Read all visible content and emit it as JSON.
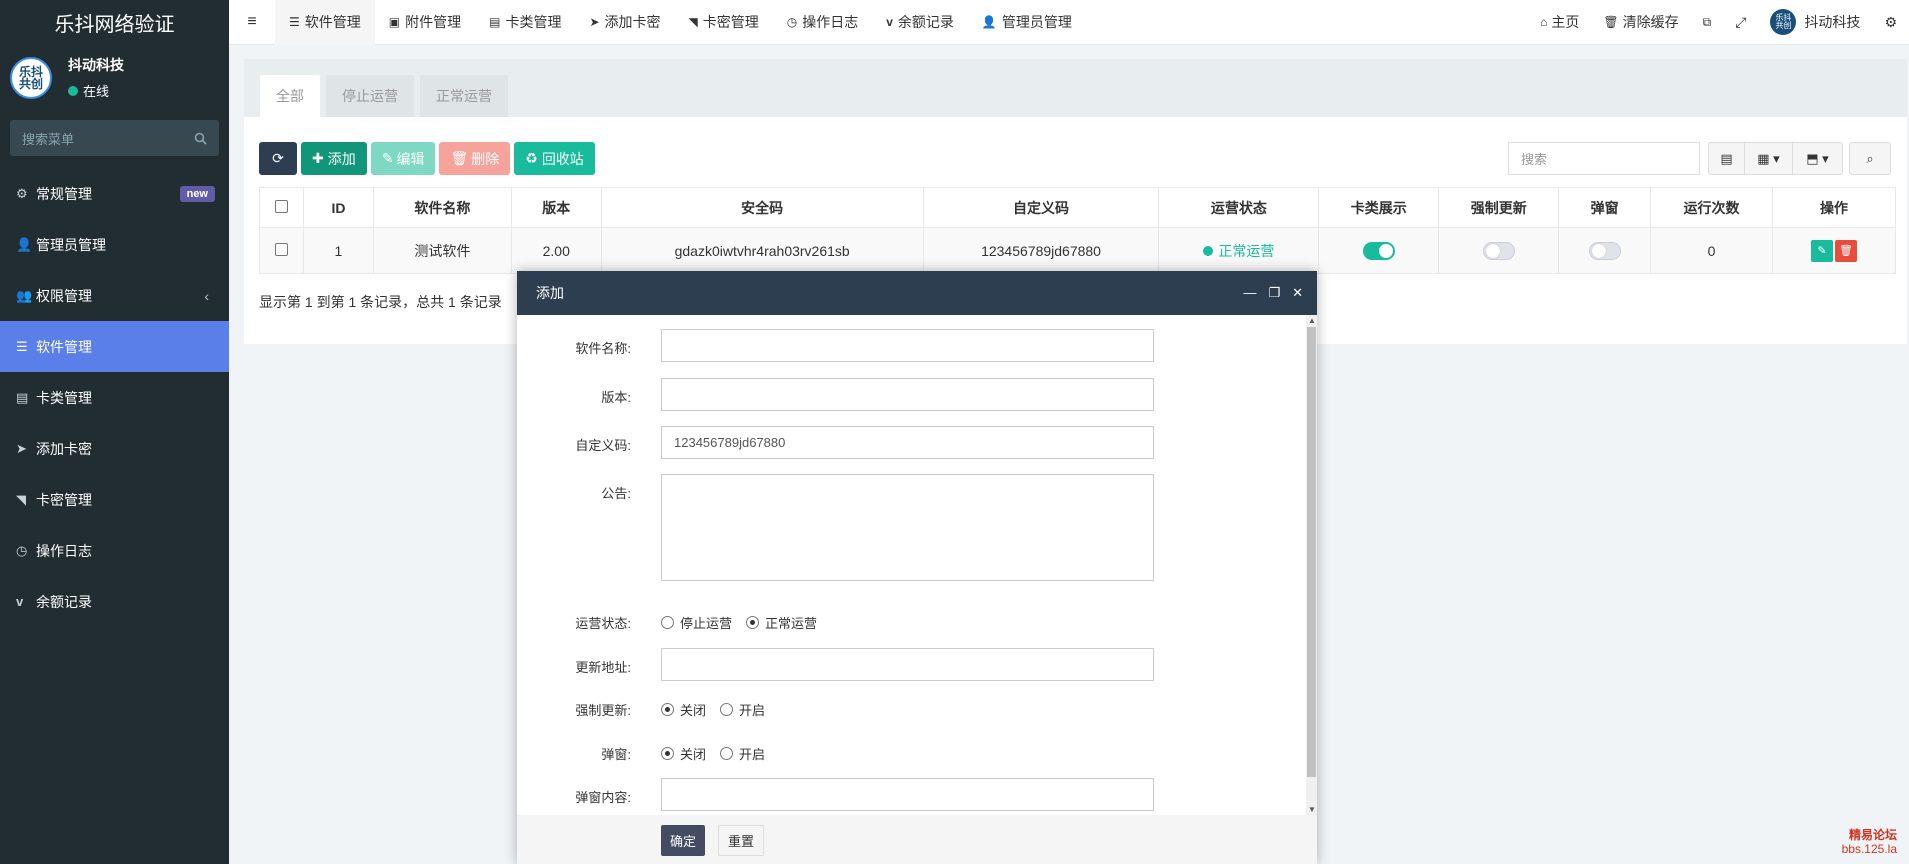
{
  "app": {
    "brand": "乐抖网络验证"
  },
  "user": {
    "avatar_text": "乐抖\n共创",
    "name": "抖动科技",
    "status": "在线"
  },
  "menu": {
    "search_placeholder": "搜索菜单",
    "items": [
      {
        "label": "常规管理",
        "icon": "cogs-icon",
        "badge": "new"
      },
      {
        "label": "管理员管理",
        "icon": "user-icon"
      },
      {
        "label": "权限管理",
        "icon": "group-icon",
        "chevron": "‹"
      },
      {
        "label": "软件管理",
        "icon": "list-icon",
        "active": true
      },
      {
        "label": "卡类管理",
        "icon": "list-alt-icon"
      },
      {
        "label": "添加卡密",
        "icon": "paper-plane-icon"
      },
      {
        "label": "卡密管理",
        "icon": "rss-icon"
      },
      {
        "label": "操作日志",
        "icon": "clock-icon"
      },
      {
        "label": "余额记录",
        "icon": "vimeo-icon"
      }
    ]
  },
  "topnav": {
    "tabs": [
      {
        "label": "软件管理",
        "icon": "list-icon",
        "active": true
      },
      {
        "label": "附件管理",
        "icon": "image-icon"
      },
      {
        "label": "卡类管理",
        "icon": "list-alt-icon"
      },
      {
        "label": "添加卡密",
        "icon": "paper-plane-icon"
      },
      {
        "label": "卡密管理",
        "icon": "rss-icon"
      },
      {
        "label": "操作日志",
        "icon": "clock-icon"
      },
      {
        "label": "余额记录",
        "icon": "vimeo-icon"
      },
      {
        "label": "管理员管理",
        "icon": "user-icon"
      }
    ],
    "right": {
      "home": "主页",
      "clear_cache": "清除缓存",
      "username": "抖动科技"
    }
  },
  "panel": {
    "tabs": [
      "全部",
      "停止运营",
      "正常运营"
    ],
    "toolbar": {
      "add": "添加",
      "edit": "编辑",
      "delete": "删除",
      "recycle": "回收站"
    },
    "search_placeholder": "搜索",
    "columns": [
      "ID",
      "软件名称",
      "版本",
      "安全码",
      "自定义码",
      "运营状态",
      "卡类展示",
      "强制更新",
      "弹窗",
      "运行次数",
      "操作"
    ],
    "rows": [
      {
        "id": "1",
        "name": "测试软件",
        "version": "2.00",
        "security": "gdazk0iwtvhr4rah03rv261sb",
        "custom": "123456789jd67880",
        "status": "正常运营",
        "card_show": true,
        "force_update": false,
        "popup": false,
        "runs": "0"
      }
    ],
    "pager": "显示第 1 到第 1 条记录，总共 1 条记录"
  },
  "modal": {
    "title": "添加",
    "fields": {
      "name_label": "软件名称:",
      "version_label": "版本:",
      "custom_label": "自定义码:",
      "custom_value": "123456789jd67880",
      "notice_label": "公告:",
      "status_label": "运营状态:",
      "status_opt_stop": "停止运营",
      "status_opt_normal": "正常运营",
      "update_url_label": "更新地址:",
      "force_label": "强制更新:",
      "force_off": "关闭",
      "force_on": "开启",
      "popup_label": "弹窗:",
      "popup_off": "关闭",
      "popup_on": "开启",
      "popup_content_label": "弹窗内容:"
    },
    "buttons": {
      "ok": "确定",
      "reset": "重置"
    }
  },
  "watermark": {
    "line1": "精易论坛",
    "line2": "bbs.125.la"
  },
  "colors": {
    "sidebar": "#222d32",
    "active": "#5b7fe8",
    "primary": "#18bc9c",
    "header": "#2c3e50"
  }
}
